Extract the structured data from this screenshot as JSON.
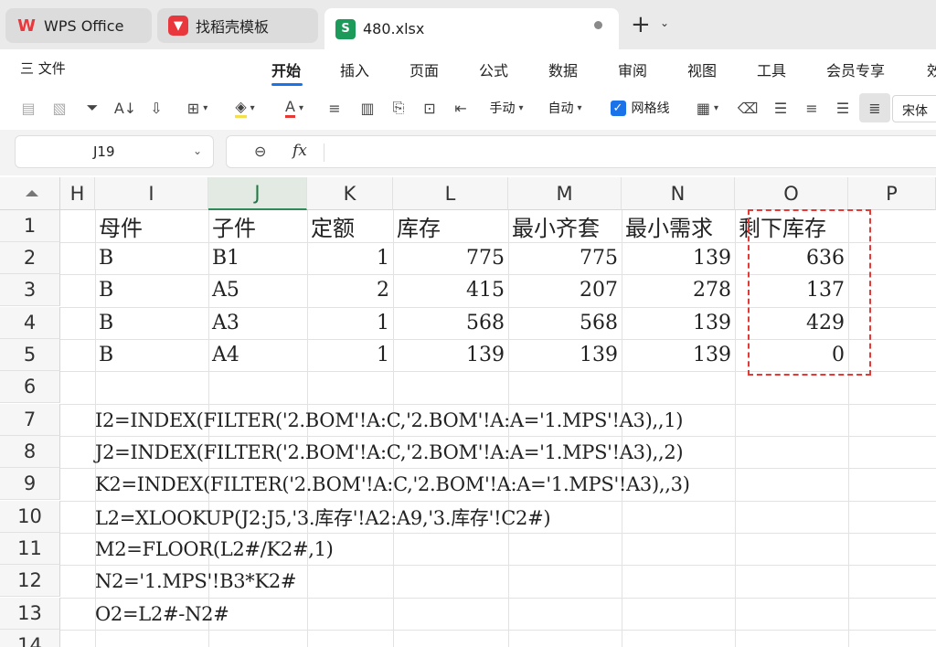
{
  "tabs": {
    "wps": "WPS Office",
    "daoke": "找稻壳模板",
    "file": "480.xlsx"
  },
  "menu": {
    "file": "三 文件",
    "items": [
      "开始",
      "插入",
      "页面",
      "公式",
      "数据",
      "审阅",
      "视图",
      "工具",
      "会员专享",
      "效"
    ]
  },
  "toolbar": {
    "manual": "手动",
    "auto": "自动",
    "gridlines": "网格线",
    "font": "宋体"
  },
  "formula_bar": {
    "cell_ref": "J19",
    "fx": "fx",
    "content": ""
  },
  "grid": {
    "columns": [
      "H",
      "I",
      "J",
      "K",
      "L",
      "M",
      "N",
      "O",
      "P"
    ],
    "selected_column": "J",
    "rows": [
      "1",
      "2",
      "3",
      "4",
      "5",
      "6",
      "7",
      "8",
      "9",
      "10",
      "11",
      "12",
      "13",
      "14"
    ],
    "header_row": [
      "母件",
      "子件",
      "定额",
      "库存",
      "最小齐套",
      "最小需求",
      "剩下库存"
    ],
    "data": [
      [
        "B",
        "B1",
        "1",
        "775",
        "775",
        "139",
        "636"
      ],
      [
        "B",
        "A5",
        "2",
        "415",
        "207",
        "278",
        "137"
      ],
      [
        "B",
        "A3",
        "1",
        "568",
        "568",
        "139",
        "429"
      ],
      [
        "B",
        "A4",
        "1",
        "139",
        "139",
        "139",
        "0"
      ]
    ],
    "formulas": [
      "I2=INDEX(FILTER('2.BOM'!A:C,'2.BOM'!A:A='1.MPS'!A3),,1)",
      "J2=INDEX(FILTER('2.BOM'!A:C,'2.BOM'!A:A='1.MPS'!A3),,2)",
      "K2=INDEX(FILTER('2.BOM'!A:C,'2.BOM'!A:A='1.MPS'!A3),,3)",
      "L2=XLOOKUP(J2:J5,'3.库存'!A2:A9,'3.库存'!C2#)",
      "M2=FLOOR(L2#/K2#,1)",
      "N2='1.MPS'!B3*K2#",
      "O2=L2#-N2#"
    ]
  },
  "colors": {
    "accent": "#1a73e8",
    "selection_green": "#2e8b57",
    "highlight_red": "#e53935"
  }
}
